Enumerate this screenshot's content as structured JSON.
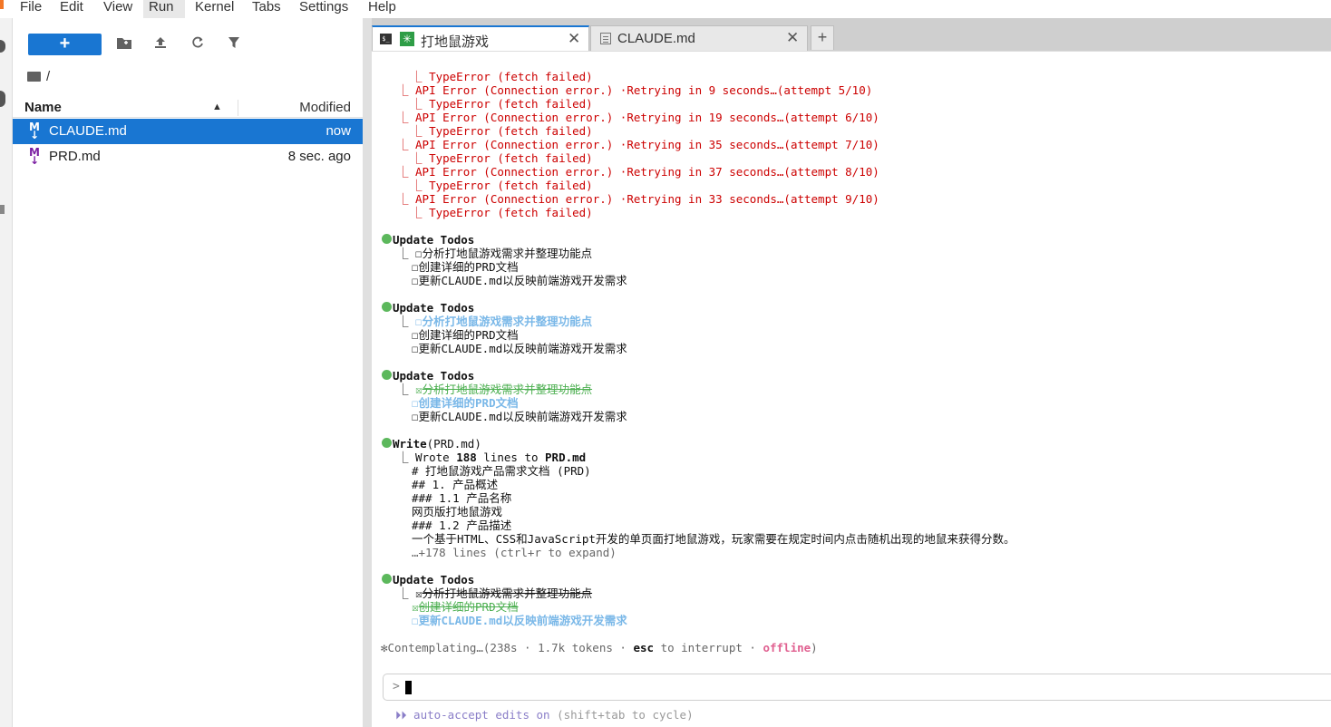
{
  "menu": {
    "items": [
      "File",
      "Edit",
      "View",
      "Run",
      "Kernel",
      "Tabs",
      "Settings",
      "Help"
    ],
    "active": "Run"
  },
  "filebrowser": {
    "new_label": "+",
    "path": "/",
    "columns": {
      "name": "Name",
      "modified": "Modified"
    },
    "files": [
      {
        "icon": "markdown-icon",
        "name": "CLAUDE.md",
        "modified": "now",
        "selected": true
      },
      {
        "icon": "markdown-icon",
        "name": "PRD.md",
        "modified": "8 sec. ago",
        "selected": false
      }
    ]
  },
  "tabs": [
    {
      "label": "打地鼠游戏",
      "icon": "terminal-icon",
      "active": true,
      "close": "✕"
    },
    {
      "label": "CLAUDE.md",
      "icon": "markdown-file-icon",
      "active": false,
      "close": "✕"
    }
  ],
  "tab_add": "+",
  "terminal": {
    "errors": [
      {
        "tree": "  ⎿ ",
        "text": "TypeError (fetch failed)"
      },
      {
        "tree": "⎿ ",
        "text": "API Error (Connection error.) ·Retrying in 9 seconds…(attempt 5/10)"
      },
      {
        "tree": "  ⎿ ",
        "text": "TypeError (fetch failed)"
      },
      {
        "tree": "⎿ ",
        "text": "API Error (Connection error.) ·Retrying in 19 seconds…(attempt 6/10)"
      },
      {
        "tree": "  ⎿ ",
        "text": "TypeError (fetch failed)"
      },
      {
        "tree": "⎿ ",
        "text": "API Error (Connection error.) ·Retrying in 35 seconds…(attempt 7/10)"
      },
      {
        "tree": "  ⎿ ",
        "text": "TypeError (fetch failed)"
      },
      {
        "tree": "⎿ ",
        "text": "API Error (Connection error.) ·Retrying in 37 seconds…(attempt 8/10)"
      },
      {
        "tree": "  ⎿ ",
        "text": "TypeError (fetch failed)"
      },
      {
        "tree": "⎿ ",
        "text": "API Error (Connection error.) ·Retrying in 33 seconds…(attempt 9/10)"
      },
      {
        "tree": "  ⎿ ",
        "text": "TypeError (fetch failed)"
      }
    ],
    "todo_blocks": [
      {
        "title": "Update Todos",
        "items": [
          {
            "box": "☐",
            "text": "分析打地鼠游戏需求并整理功能点",
            "style": "dark"
          },
          {
            "box": "☐",
            "text": "创建详细的PRD文档",
            "style": "dark"
          },
          {
            "box": "☐",
            "text": "更新CLAUDE.md以反映前端游戏开发需求",
            "style": "dark"
          }
        ]
      },
      {
        "title": "Update Todos",
        "items": [
          {
            "box": "☐",
            "text": "分析打地鼠游戏需求并整理功能点",
            "style": "blue"
          },
          {
            "box": "☐",
            "text": "创建详细的PRD文档",
            "style": "dark"
          },
          {
            "box": "☐",
            "text": "更新CLAUDE.md以反映前端游戏开发需求",
            "style": "dark"
          }
        ]
      },
      {
        "title": "Update Todos",
        "items": [
          {
            "box": "☒",
            "text": "分析打地鼠游戏需求并整理功能点",
            "style": "green-strike"
          },
          {
            "box": "☐",
            "text": "创建详细的PRD文档",
            "style": "blue"
          },
          {
            "box": "☐",
            "text": "更新CLAUDE.md以反映前端游戏开发需求",
            "style": "dark"
          }
        ]
      }
    ],
    "write_block": {
      "title": "Write",
      "arg": "(PRD.md)",
      "summary_prefix": "Wrote ",
      "summary_count": "188",
      "summary_mid": " lines to ",
      "summary_file": "PRD.md",
      "lines": [
        "# 打地鼠游戏产品需求文档 (PRD)",
        "## 1. 产品概述",
        "### 1.1 产品名称",
        "网页版打地鼠游戏",
        "### 1.2 产品描述",
        "一个基于HTML、CSS和JavaScript开发的单页面打地鼠游戏，玩家需要在规定时间内点击随机出现的地鼠来获得分数。"
      ],
      "more": "…+178 lines (ctrl+r to expand)"
    },
    "final_todos": {
      "title": "Update Todos",
      "items": [
        {
          "box": "☒",
          "text": "分析打地鼠游戏需求并整理功能点",
          "style": "dark-strike"
        },
        {
          "box": "☒",
          "text": "创建详细的PRD文档",
          "style": "green-strike"
        },
        {
          "box": "☐",
          "text": "更新CLAUDE.md以反映前端游戏开发需求",
          "style": "blue"
        }
      ]
    },
    "status": {
      "spinner": "✻",
      "text": "Contemplating…(238s · 1.7k tokens ·",
      "esc": "esc",
      "esc_suffix": " to interrupt ·",
      "offline": "offline",
      "close": ")"
    },
    "prompt_symbol": ">",
    "autoaccept": {
      "arrows": "⏵⏵",
      "label": " auto-accept edits on ",
      "hint": "(shift+tab to cycle)"
    }
  }
}
